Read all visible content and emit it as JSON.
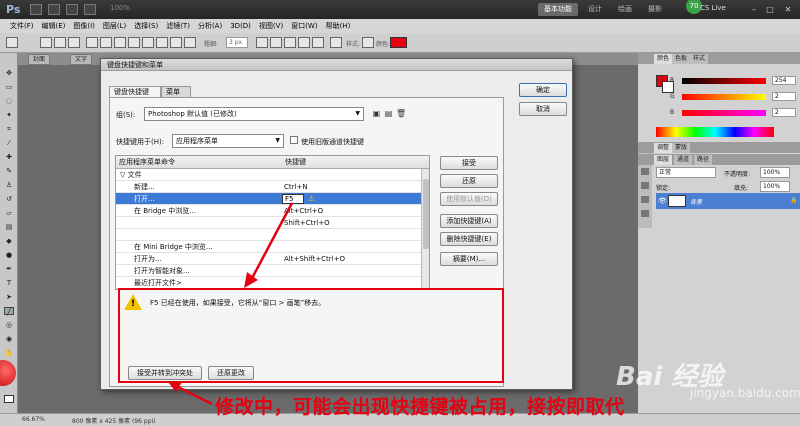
{
  "app": {
    "logo": "Ps",
    "zoom_label": "100%",
    "workspaces": [
      "基本功能",
      "设计",
      "绘画",
      "摄影"
    ],
    "active_workspace": 0,
    "badge": "70",
    "cs_live": "CS Live"
  },
  "menubar": [
    "文件(F)",
    "编辑(E)",
    "图像(I)",
    "图层(L)",
    "选择(S)",
    "滤镜(T)",
    "分析(A)",
    "3D(D)",
    "视图(V)",
    "窗口(W)",
    "帮助(H)"
  ],
  "options": {
    "width_label": "粗细:",
    "width_value": "3 px",
    "style_label": "样式:",
    "color_label": "颜色:",
    "color": "#e60012"
  },
  "doc_tabs": [
    "封面",
    "文字"
  ],
  "statusbar": {
    "zoom": "66.67%",
    "doc_info": "800 像素 x 425 像素 (96 ppi)"
  },
  "right_panel": {
    "color_tabs": [
      "颜色",
      "色板",
      "样式"
    ],
    "sliders": [
      {
        "label": "R",
        "value": "254",
        "gradient": "linear-gradient(90deg,#000,#f00)"
      },
      {
        "label": "G",
        "value": "2",
        "gradient": "linear-gradient(90deg,#f00,#ff0)"
      },
      {
        "label": "B",
        "value": "2",
        "gradient": "linear-gradient(90deg,#f00,#f0f)"
      }
    ],
    "adjust_tabs": [
      "调整",
      "蒙版"
    ],
    "layer_tabs": [
      "图层",
      "通道",
      "路径"
    ],
    "blend_mode": "正常",
    "opacity_label": "不透明度:",
    "opacity": "100%",
    "fill_label": "填充:",
    "fill": "100%",
    "lock_label": "锁定:",
    "layer_name": "背景"
  },
  "dialog": {
    "title": "键盘快捷键和菜单",
    "tabs": [
      "键盘快捷键",
      "菜单"
    ],
    "set_label": "组(S):",
    "set_value": "Photoshop 默认值 (已修改)",
    "for_label": "快捷键用于(H):",
    "for_value": "应用程序菜单",
    "legacy_label": "使用旧版通道快捷键",
    "col_command": "应用程序菜单命令",
    "col_shortcut": "快捷键",
    "rows": [
      {
        "command": "▽ 文件",
        "shortcut": ""
      },
      {
        "command": "新建...",
        "shortcut": "Ctrl+N"
      },
      {
        "command": "打开...",
        "shortcut": "F5"
      },
      {
        "command": "在 Bridge 中浏览...",
        "shortcut": "Alt+Ctrl+O"
      },
      {
        "command": "",
        "shortcut": "Shift+Ctrl+O"
      },
      {
        "command": "在 Mini Bridge 中浏览...",
        "shortcut": ""
      },
      {
        "command": "打开为...",
        "shortcut": "Alt+Shift+Ctrl+O"
      },
      {
        "command": "打开为智能对象...",
        "shortcut": ""
      },
      {
        "command": "最近打开文件>",
        "shortcut": ""
      }
    ],
    "side_buttons": [
      "接受",
      "还原",
      "使用默认值(D)",
      "添加快捷键(A)",
      "删除快捷键(E)",
      "摘要(M)..."
    ],
    "ok": "确定",
    "cancel": "取消",
    "message": "F5 已经在使用，如果接受，它将从“窗口 > 画笔”移去。",
    "accept_conflict": "接受并转到冲突处",
    "undo_changes": "还原更改"
  },
  "annotation": "修改中，可能会出现快捷键被占用，接按即取代",
  "watermark": {
    "brand": "Bai 经验",
    "url": "jingyan.baidu.com"
  }
}
